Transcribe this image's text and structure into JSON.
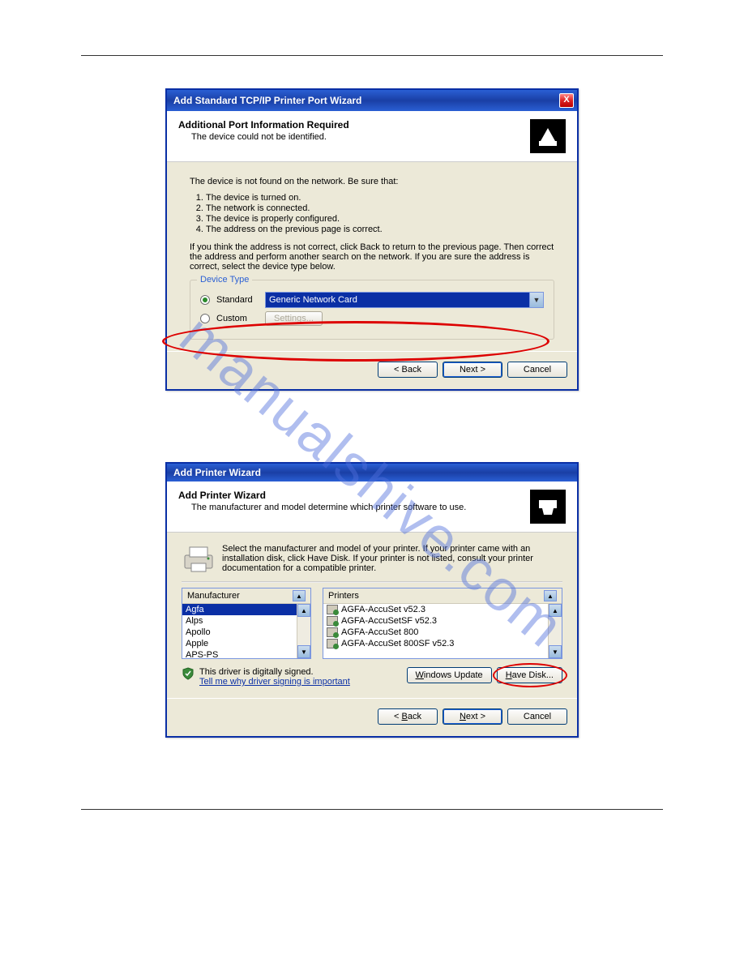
{
  "watermark": "manualshive.com",
  "dialog1": {
    "title": "Add Standard TCP/IP Printer Port Wizard",
    "close_label": "X",
    "header_title": "Additional Port Information Required",
    "header_sub": "The device could not be identified.",
    "intro": "The device is not found on the network.  Be sure that:",
    "steps": [
      "The device is turned on.",
      "The network is connected.",
      "The device is properly configured.",
      "The address on the previous page is correct."
    ],
    "note": "If you think the address is not correct, click Back to return to the previous page.  Then correct the address and perform another search on the network.  If you are sure the address is correct, select the device type below.",
    "group_legend": "Device Type",
    "radio_standard": "Standard",
    "radio_custom": "Custom",
    "combo_value": "Generic Network Card",
    "settings_btn": "Settings...",
    "back_btn": "< Back",
    "next_btn": "Next >",
    "cancel_btn": "Cancel"
  },
  "dialog2": {
    "title": "Add Printer Wizard",
    "header_title": "Add Printer Wizard",
    "header_sub": "The manufacturer and model determine which printer software to use.",
    "info": "Select the manufacturer and model of your printer. If your printer came with an installation disk, click Have Disk. If your printer is not listed, consult your printer documentation for a compatible printer.",
    "manufacturer_header": "Manufacturer",
    "printers_header": "Printers",
    "manufacturers": [
      "Agfa",
      "Alps",
      "Apollo",
      "Apple",
      "APS-PS"
    ],
    "printers": [
      "AGFA-AccuSet v52.3",
      "AGFA-AccuSetSF v52.3",
      "AGFA-AccuSet 800",
      "AGFA-AccuSet 800SF v52.3"
    ],
    "signed_text": "This driver is digitally signed.",
    "signed_link": "Tell me why driver signing is important",
    "windows_update_btn": "Windows Update",
    "have_disk_btn": "Have Disk...",
    "back_btn": "< Back",
    "next_btn": "Next >",
    "cancel_btn": "Cancel"
  }
}
